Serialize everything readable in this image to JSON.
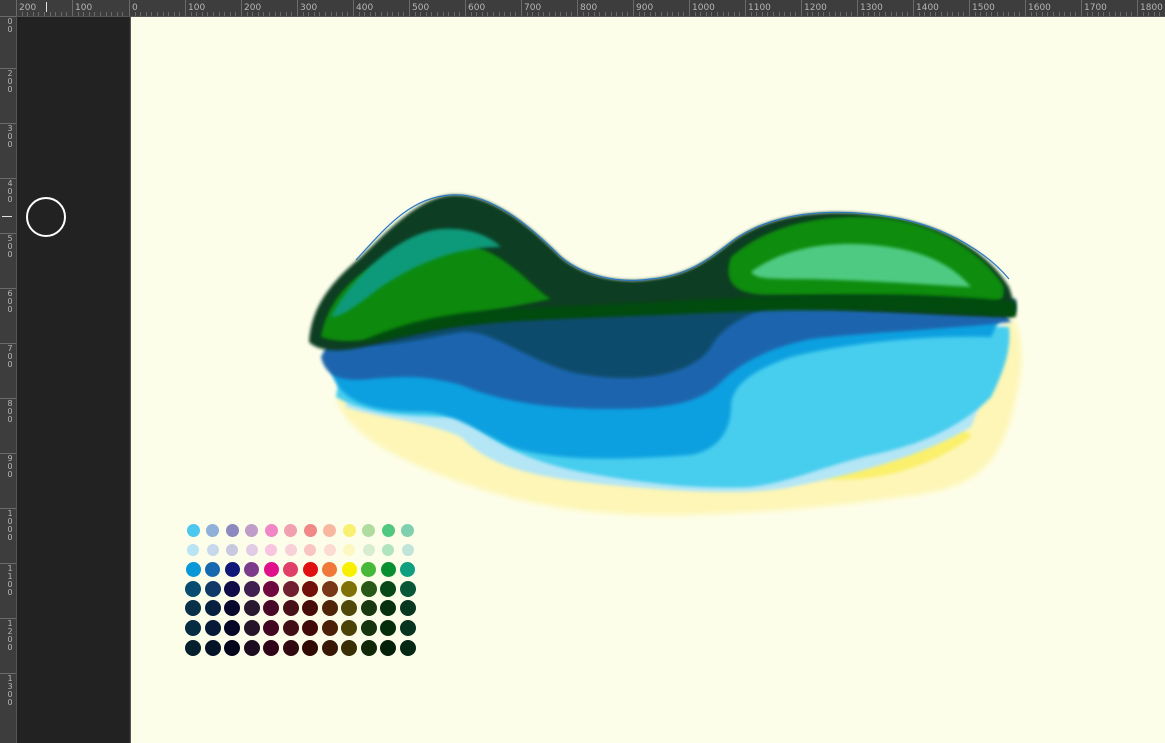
{
  "rulers": {
    "horizontal_labels": [
      "200",
      "100",
      "0",
      "100",
      "200",
      "300",
      "400",
      "500",
      "600",
      "700",
      "800",
      "900",
      "1000",
      "1100",
      "1200",
      "1300",
      "1400",
      "1500",
      "1600",
      "1700",
      "1800"
    ],
    "vertical_labels": [
      "0\n0",
      "2\n0\n0",
      "3\n0\n0",
      "4\n0\n0",
      "5\n0\n0",
      "6\n0\n0",
      "7\n0\n0",
      "8\n0\n0",
      "9\n0\n0",
      "1\n0\n0\n0",
      "1\n1\n0\n0",
      "1\n2\n0\n0",
      "1\n3\n0\n0"
    ]
  },
  "tool": {
    "cursor": "brush-circle-cursor"
  },
  "canvas": {
    "background": "#fdfeea"
  },
  "palette": {
    "rows": [
      [
        "#4cc8ee",
        "#8fb0d8",
        "#8c88c0",
        "#c09cc8",
        "#f086c8",
        "#f0a0b0",
        "#f08888",
        "#f8b8a0",
        "#f8f070",
        "#b0dca0",
        "#50c880",
        "#80d0b0"
      ],
      [
        "#b8e4f4",
        "#c8d8ec",
        "#c8c8e0",
        "#e0cce4",
        "#f8c4e0",
        "#f8d0d8",
        "#f8c4c4",
        "#fcdcd0",
        "#fcf8c0",
        "#d8ecd0",
        "#b0e4c0",
        "#c0e4d8"
      ],
      [
        "#0898d8",
        "#1868b0",
        "#101878",
        "#7c3c8c",
        "#e0108c",
        "#e04068",
        "#e01010",
        "#f07838",
        "#f8f000",
        "#48b838",
        "#089030",
        "#10a080"
      ],
      [
        "#084c70",
        "#103868",
        "#100c48",
        "#402050",
        "#700840",
        "#702030",
        "#701008",
        "#783818",
        "#807008",
        "#285818",
        "#084818",
        "#085838"
      ],
      [
        "#083048",
        "#082040",
        "#08082c",
        "#281830",
        "#480828",
        "#481018",
        "#480c08",
        "#502408",
        "#504808",
        "#183810",
        "#083010",
        "#083820"
      ],
      [
        "#062c42",
        "#061a38",
        "#060626",
        "#261428",
        "#420622",
        "#420e16",
        "#420a06",
        "#4a2006",
        "#4a4206",
        "#163410",
        "#062c0e",
        "#06341e"
      ],
      [
        "#04202c",
        "#041428",
        "#04041c",
        "#1c0c20",
        "#300418",
        "#300810",
        "#300804",
        "#381804",
        "#383004",
        "#102808",
        "#04200a",
        "#042814"
      ]
    ]
  }
}
